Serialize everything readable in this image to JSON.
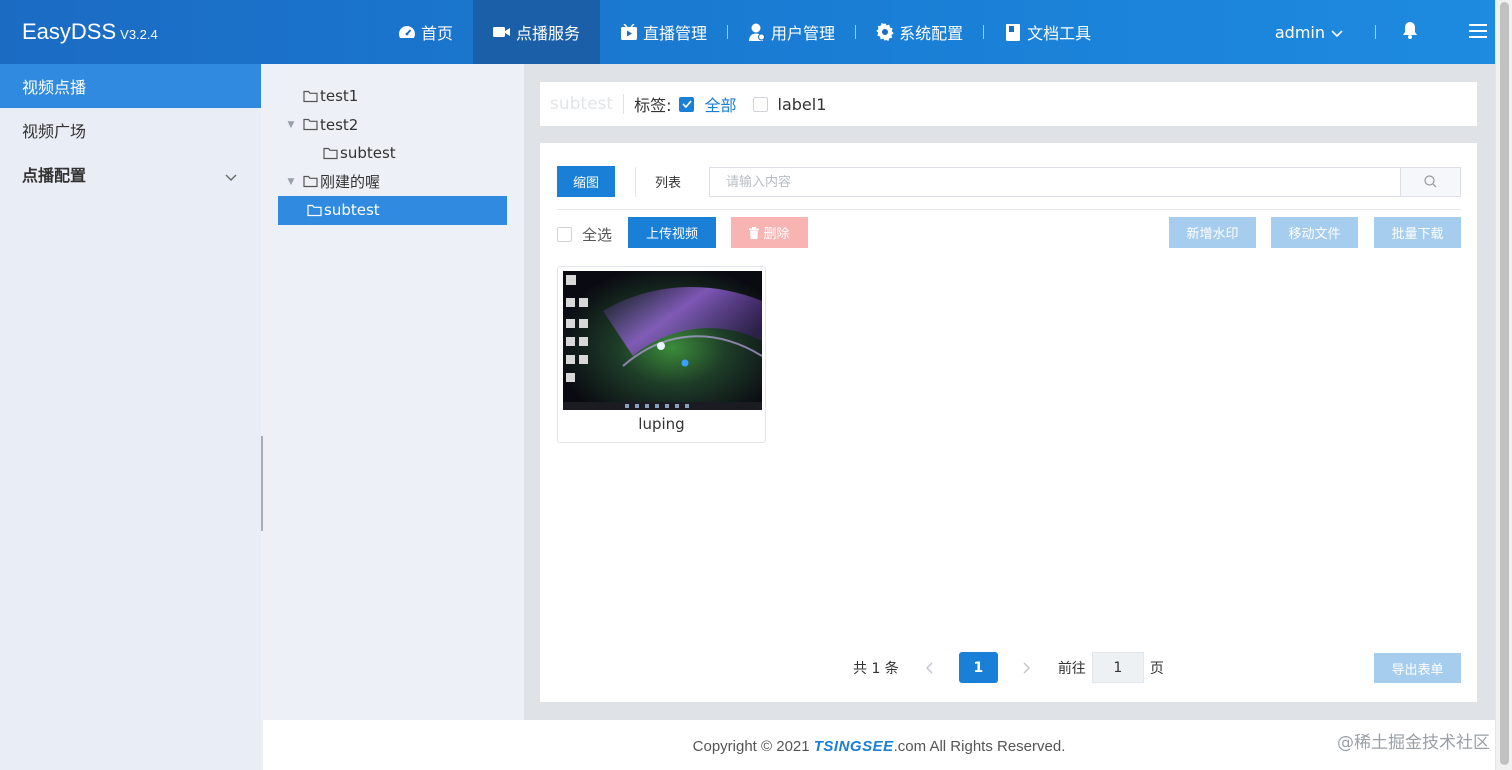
{
  "brand": {
    "name": "EasyDSS",
    "version": "V3.2.4"
  },
  "nav": [
    {
      "label": "首页",
      "icon": "dashboard-icon",
      "active": false
    },
    {
      "label": "点播服务",
      "icon": "video-camera-icon",
      "active": true
    },
    {
      "label": "直播管理",
      "icon": "live-play-icon",
      "active": false
    },
    {
      "label": "用户管理",
      "icon": "user-icon",
      "active": false
    },
    {
      "label": "系统配置",
      "icon": "gear-icon",
      "active": false
    },
    {
      "label": "文档工具",
      "icon": "document-icon",
      "active": false
    }
  ],
  "header_right": {
    "user": "admin",
    "icons": [
      "bell-icon",
      "menu-icon"
    ]
  },
  "sidebar": {
    "items": [
      {
        "label": "视频点播",
        "active": true
      },
      {
        "label": "视频广场",
        "active": false
      },
      {
        "label": "点播配置",
        "active": false,
        "expandable": true
      }
    ]
  },
  "tree": {
    "nodes": [
      {
        "label": "test1",
        "expanded": null,
        "selected": false
      },
      {
        "label": "test2",
        "expanded": true,
        "selected": false
      },
      {
        "label": "subtest",
        "expanded": null,
        "selected": false
      },
      {
        "label": "刚建的喔",
        "expanded": true,
        "selected": false
      },
      {
        "label": "subtest",
        "expanded": null,
        "selected": true
      }
    ]
  },
  "tagbar": {
    "folder": "subtest",
    "label": "标签:",
    "options": [
      {
        "label": "全部",
        "checked": true
      },
      {
        "label": "label1",
        "checked": false
      }
    ]
  },
  "view": {
    "grid_label": "缩图",
    "list_label": "列表"
  },
  "search": {
    "placeholder": "请输入内容",
    "value": ""
  },
  "actions": {
    "select_all": "全选",
    "upload": "上传视频",
    "delete": "删除",
    "watermark": "新增水印",
    "move": "移动文件",
    "download": "批量下载"
  },
  "videos": [
    {
      "name": "luping"
    }
  ],
  "pagination": {
    "total": "共 1 条",
    "current": "1",
    "goto_label": "前往",
    "goto_value": "1",
    "unit": "页",
    "export": "导出表单"
  },
  "footer": {
    "prefix": "Copyright © 2021 ",
    "brand": "TSINGSEE",
    "suffix": ".com All Rights Reserved."
  },
  "watermark": "@稀土掘金技术社区",
  "colors": {
    "primary": "#1a7fd6",
    "header": "#1b6bc3",
    "danger_light": "#f8b3b3",
    "disabled_blue": "#a6cdee"
  }
}
